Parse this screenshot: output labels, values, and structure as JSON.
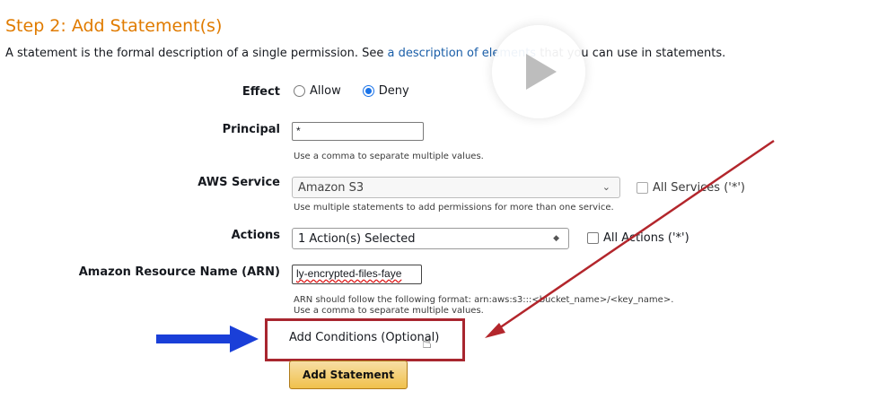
{
  "heading": "Step 2: Add Statement(s)",
  "description": {
    "before": "A statement is the formal description of a single permission. See ",
    "link": "a description of elements",
    "after": " that you can use in statements."
  },
  "form": {
    "effect": {
      "label": "Effect",
      "options": [
        {
          "label": "Allow",
          "selected": false
        },
        {
          "label": "Deny",
          "selected": true
        }
      ]
    },
    "principal": {
      "label": "Principal",
      "value": "*",
      "hint": "Use a comma to separate multiple values."
    },
    "aws_service": {
      "label": "AWS Service",
      "value": "Amazon S3",
      "hint": "Use multiple statements to add permissions for more than one service.",
      "all_label": "All Services ('*')"
    },
    "actions": {
      "label": "Actions",
      "value": "1 Action(s) Selected",
      "all_label": "All Actions ('*')"
    },
    "arn": {
      "label": "Amazon Resource Name (ARN)",
      "value": "ly-encrypted-files-faye",
      "hint_line1": "ARN should follow the following format: arn:aws:s3:::<bucket_name>/<key_name>.",
      "hint_line2": "Use a comma to separate multiple values."
    },
    "add_conditions": "Add Conditions (Optional)",
    "add_statement": "Add Statement"
  },
  "icons": {
    "play": "play-icon",
    "arrow_blue": "blue-arrow-icon",
    "arrow_red": "red-arrow-icon",
    "cursor": "hand-pointer-icon"
  },
  "colors": {
    "heading": "#e07b00",
    "link": "#1a5ea8",
    "highlight_box": "#a8262f",
    "blue_arrow": "#1a3fd8",
    "red_arrow": "#b3262c",
    "button": "#f0c14b"
  }
}
